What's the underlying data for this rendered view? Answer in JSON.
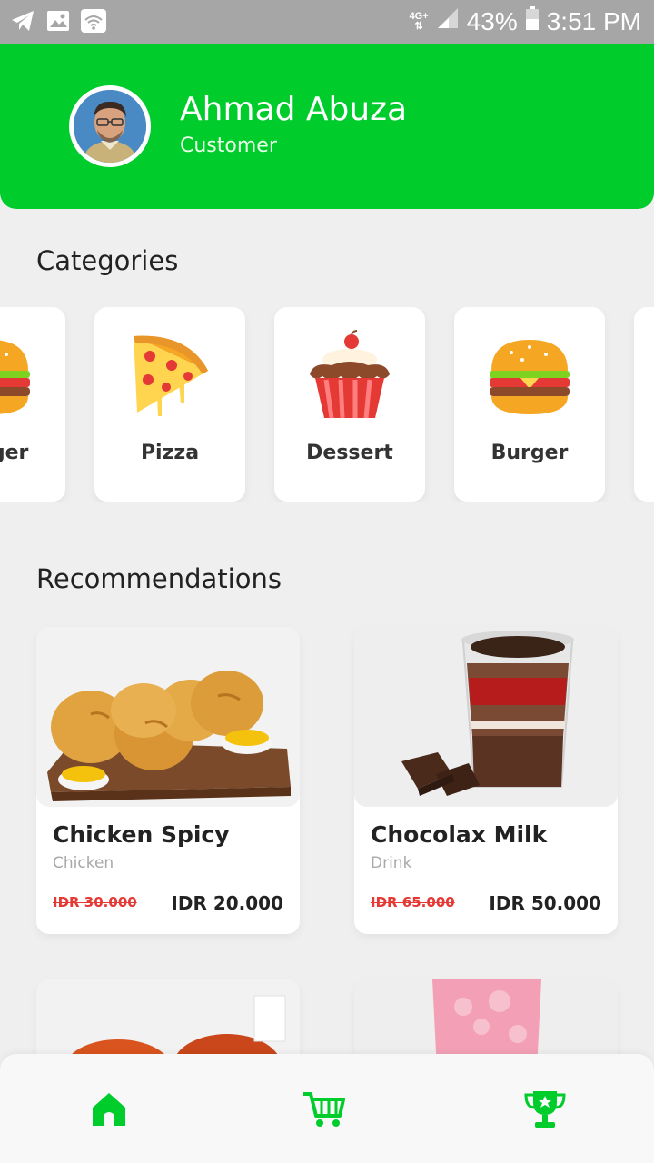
{
  "status_bar": {
    "network": "4G+",
    "battery": "43%",
    "time": "3:51 PM",
    "icons": [
      "telegram-icon",
      "image-icon",
      "wifi-icon"
    ]
  },
  "profile": {
    "name": "Ahmad Abuza",
    "role": "Customer"
  },
  "categories": {
    "title": "Categories",
    "items": [
      {
        "label": "Burger",
        "icon": "burger-icon"
      },
      {
        "label": "Pizza",
        "icon": "pizza-icon"
      },
      {
        "label": "Dessert",
        "icon": "cupcake-icon"
      },
      {
        "label": "Burger",
        "icon": "burger-icon"
      }
    ]
  },
  "recommendations": {
    "title": "Recommendations",
    "items": [
      {
        "name": "Chicken Spicy",
        "category": "Chicken",
        "old_price": "IDR 30.000",
        "price": "IDR 20.000"
      },
      {
        "name": "Chocolax Milk",
        "category": "Drink",
        "old_price": "IDR 65.000",
        "price": "IDR 50.000"
      }
    ]
  },
  "nav": {
    "items": [
      "home-icon",
      "cart-icon",
      "trophy-icon"
    ],
    "accent": "#00cc2c"
  },
  "colors": {
    "header": "#00cc2c",
    "strike_price": "#e53935",
    "background": "#efefef"
  }
}
